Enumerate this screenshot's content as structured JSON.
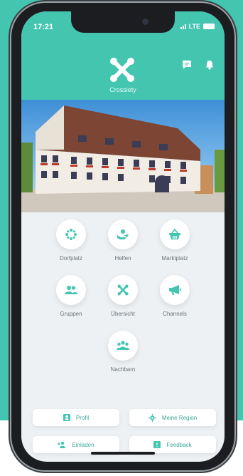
{
  "colors": {
    "accent": "#43c5b0",
    "tile_label": "#6b7378",
    "button_text": "#3aa996"
  },
  "status": {
    "time": "17:21",
    "network": "LTE"
  },
  "header": {
    "title": "Crossiety",
    "icons": [
      "crossiety-logo-icon",
      "chat-icon",
      "bell-icon"
    ]
  },
  "hero": {
    "description_icon": "town-hall-photo"
  },
  "tiles": [
    {
      "label": "Dorfplatz",
      "icon": "dorfplatz-icon"
    },
    {
      "label": "Helfen",
      "icon": "helfen-icon"
    },
    {
      "label": "Marktplatz",
      "icon": "basket-icon"
    },
    {
      "label": "Gruppen",
      "icon": "groups-icon"
    },
    {
      "label": "Übersicht",
      "icon": "overview-icon"
    },
    {
      "label": "Channels",
      "icon": "megaphone-icon"
    },
    {
      "label": "Nachbarn",
      "icon": "neighbors-icon"
    }
  ],
  "buttons": [
    {
      "label": "Profil",
      "icon": "profile-icon"
    },
    {
      "label": "Meine Region",
      "icon": "region-icon"
    },
    {
      "label": "Einladen",
      "icon": "invite-icon"
    },
    {
      "label": "Feedback",
      "icon": "feedback-icon"
    }
  ]
}
